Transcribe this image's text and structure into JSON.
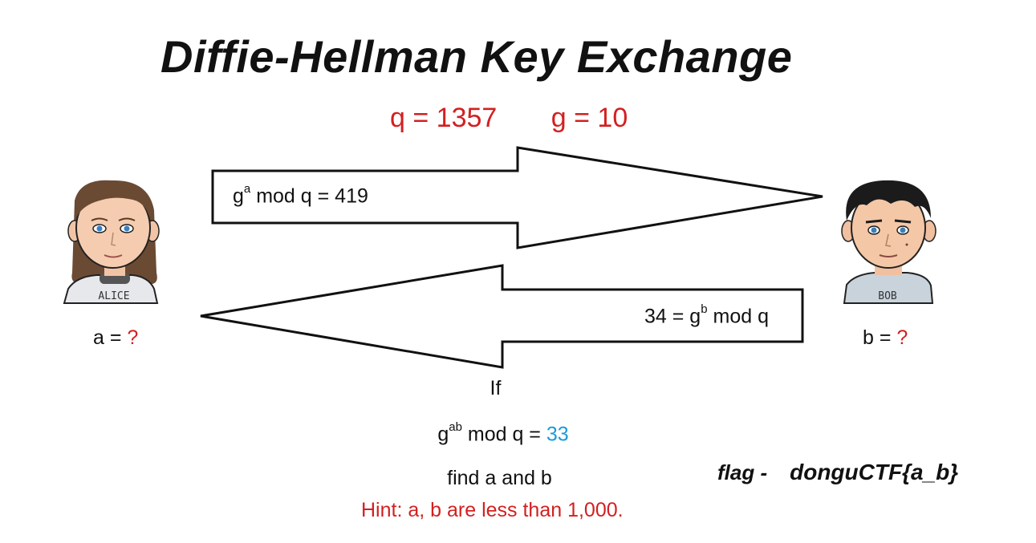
{
  "title": "Diffie-Hellman Key Exchange",
  "params": {
    "q": "q = 1357",
    "g": "g = 10"
  },
  "alice": {
    "badge": "ALICE",
    "secret_prefix": "a = ",
    "secret_value": "?"
  },
  "bob": {
    "badge": "BOB",
    "secret_prefix": "b = ",
    "secret_value": "?"
  },
  "arrow_to_bob": {
    "base": "g",
    "exp": "a",
    "rest": " mod q = 419"
  },
  "arrow_to_alice": {
    "prefix": "34 = g",
    "exp": "b",
    "rest": " mod q"
  },
  "condition": {
    "if": "If",
    "base": "g",
    "exp": "ab",
    "rest": " mod q = ",
    "value": "33",
    "find": "find a and b",
    "hint": "Hint:  a, b are less than 1,000."
  },
  "flag": {
    "label": "flag -",
    "value": "donguCTF{a_b}"
  },
  "colors": {
    "accent_red": "#d32020",
    "accent_blue": "#1a9bd7"
  }
}
